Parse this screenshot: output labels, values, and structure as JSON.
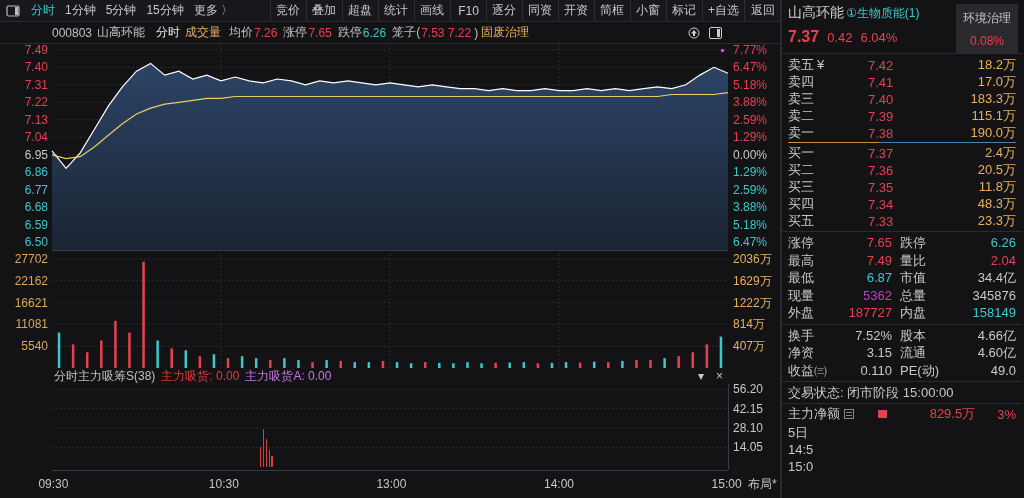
{
  "toolbar": {
    "tabs": [
      {
        "label": "分时",
        "selected": true
      },
      {
        "label": "1分钟",
        "selected": false
      },
      {
        "label": "5分钟",
        "selected": false
      },
      {
        "label": "15分钟",
        "selected": false
      },
      {
        "label": "更多 〉",
        "selected": false
      }
    ],
    "buttons": [
      "竞价",
      "叠加",
      "超盘",
      "统计",
      "画线",
      "F10",
      "逐分",
      "同资",
      "开资",
      "简框",
      "小窗",
      "标记",
      "+自选",
      "返回"
    ]
  },
  "info_bar": {
    "code": "000803",
    "name": "山高环能",
    "mode": "分时",
    "indicator": "成交量",
    "fields": [
      {
        "label": "均价",
        "value": "7.26",
        "kind": "up"
      },
      {
        "label": "涨停",
        "value": "7.65",
        "kind": "up"
      },
      {
        "label": "跌停",
        "value": "6.26",
        "kind": "down"
      },
      {
        "label": "笼子(",
        "value": "7.53 7.22",
        "kind": "up",
        "suffix": ")"
      }
    ],
    "sector": "固废治理"
  },
  "price_chart": {
    "chart_data": {
      "type": "line",
      "categories": [
        null,
        null,
        null,
        null,
        null,
        null,
        null,
        null,
        null,
        null,
        null,
        null,
        null,
        null,
        null,
        null,
        null,
        null,
        null,
        null,
        null,
        null,
        null,
        null,
        null,
        null,
        null,
        null,
        null,
        null,
        null,
        null,
        null,
        null,
        null,
        null,
        null,
        null,
        null,
        null,
        null,
        null,
        null,
        null,
        null,
        null,
        null,
        null,
        null
      ],
      "series": [
        {
          "color": "#ffffff",
          "values": [
            6.97,
            6.88,
            6.96,
            7.08,
            7.2,
            7.3,
            7.38,
            7.42,
            7.36,
            7.38,
            7.34,
            7.36,
            7.33,
            7.35,
            7.33,
            7.32,
            7.34,
            7.33,
            7.31,
            7.33,
            7.32,
            7.33,
            7.32,
            7.31,
            7.32,
            7.31,
            7.3,
            7.31,
            7.3,
            7.29,
            7.29,
            7.28,
            7.29,
            7.28,
            7.28,
            7.29,
            7.28,
            7.28,
            7.29,
            7.28,
            7.29,
            7.28,
            7.29,
            7.3,
            7.29,
            7.31,
            7.36,
            7.4,
            7.37
          ]
        },
        {
          "color": "#e8d060",
          "values": [
            6.95,
            6.93,
            6.94,
            6.99,
            7.05,
            7.11,
            7.16,
            7.19,
            7.21,
            7.22,
            7.23,
            7.24,
            7.24,
            7.25,
            7.25,
            7.25,
            7.25,
            7.25,
            7.25,
            7.25,
            7.25,
            7.25,
            7.25,
            7.25,
            7.25,
            7.25,
            7.25,
            7.25,
            7.25,
            7.25,
            7.25,
            7.25,
            7.25,
            7.25,
            7.25,
            7.25,
            7.25,
            7.25,
            7.25,
            7.25,
            7.25,
            7.25,
            7.25,
            7.25,
            7.26,
            7.26,
            7.26,
            7.26,
            7.27
          ]
        }
      ],
      "ylim": [
        6.46,
        7.52
      ],
      "grid": true,
      "yticks": [
        {
          "value": 7.49,
          "label": "7.49"
        },
        {
          "value": 7.4,
          "label": "7.40"
        },
        {
          "value": 7.31,
          "label": "7.31"
        },
        {
          "value": 7.22,
          "label": "7.22"
        },
        {
          "value": 7.13,
          "label": "7.13"
        },
        {
          "value": 7.04,
          "label": "7.04"
        },
        {
          "value": 6.95,
          "label": "6.95"
        },
        {
          "value": 6.86,
          "label": "6.86"
        },
        {
          "value": 6.77,
          "label": "6.77"
        },
        {
          "value": 6.68,
          "label": "6.68"
        },
        {
          "value": 6.59,
          "label": "6.59"
        },
        {
          "value": 6.5,
          "label": "6.50"
        }
      ]
    },
    "pct_labels": [
      {
        "text": "7.77%",
        "color": "#e8404f"
      },
      {
        "text": "6.47%",
        "color": "#e8404f"
      },
      {
        "text": "5.18%",
        "color": "#e8404f"
      },
      {
        "text": "3.88%",
        "color": "#e8404f"
      },
      {
        "text": "2.59%",
        "color": "#e8404f"
      },
      {
        "text": "1.29%",
        "color": "#e8404f"
      },
      {
        "text": "0.00%",
        "color": "#c8c8c8"
      },
      {
        "text": "1.29%",
        "color": "#3cc8c8"
      },
      {
        "text": "2.59%",
        "color": "#3cc8c8"
      },
      {
        "text": "3.88%",
        "color": "#3cc8c8"
      },
      {
        "text": "5.18%",
        "color": "#3cc8c8"
      },
      {
        "text": "6.47%",
        "color": "#3cc8c8"
      }
    ]
  },
  "volume_chart": {
    "chart_data": {
      "type": "bar",
      "grid": true,
      "categories": [
        null,
        null,
        null,
        null,
        null,
        null,
        null,
        null,
        null,
        null,
        null,
        null,
        null,
        null,
        null,
        null,
        null,
        null,
        null,
        null,
        null,
        null,
        null,
        null,
        null,
        null,
        null,
        null,
        null,
        null,
        null,
        null,
        null,
        null,
        null,
        null,
        null,
        null,
        null,
        null,
        null,
        null,
        null,
        null,
        null,
        null,
        null,
        null
      ],
      "series": [
        {
          "color": "#e8404f",
          "values": [
            0,
            6000,
            4000,
            7000,
            12000,
            9000,
            27000,
            0,
            5000,
            0,
            3000,
            0,
            2500,
            0,
            0,
            2000,
            0,
            0,
            1500,
            0,
            1800,
            0,
            0,
            1800,
            0,
            0,
            1500,
            0,
            0,
            0,
            0,
            1300,
            0,
            0,
            1200,
            0,
            0,
            1400,
            0,
            1500,
            0,
            2000,
            2000,
            0,
            3000,
            4000,
            6000,
            0
          ]
        },
        {
          "color": "#3cc8c8",
          "values": [
            9000,
            0,
            0,
            0,
            0,
            0,
            0,
            7000,
            0,
            4500,
            0,
            3500,
            0,
            3000,
            2500,
            0,
            2500,
            2000,
            0,
            2000,
            0,
            1500,
            1500,
            0,
            1500,
            1200,
            0,
            1300,
            1200,
            1500,
            1200,
            0,
            1400,
            1500,
            0,
            1300,
            1500,
            0,
            1600,
            0,
            1800,
            0,
            0,
            2500,
            0,
            0,
            0,
            8000
          ]
        }
      ],
      "ylim": [
        0,
        30000
      ],
      "yticks": [
        {
          "value": 27702,
          "label": "27702"
        },
        {
          "value": 22162,
          "label": "22162"
        },
        {
          "value": 16621,
          "label": "16621"
        },
        {
          "value": 11081,
          "label": "11081"
        },
        {
          "value": 5540,
          "label": "5540"
        }
      ]
    },
    "amount_labels": [
      "2036万",
      "1629万",
      "1222万",
      "814万",
      "407万"
    ]
  },
  "indicator": {
    "title": "分时主力吸筹S(38)",
    "legend": [
      {
        "text": "主力吸货: 0.00",
        "color": "#e03a3a"
      },
      {
        "text": "主力吸货A: 0.00",
        "color": "#c57ae0"
      }
    ],
    "controls": [
      "▾",
      "×"
    ],
    "chart_data": {
      "type": "bar",
      "grid": true,
      "categories": [
        "09:30",
        null,
        null,
        null,
        null,
        null,
        null,
        null,
        null,
        null,
        null,
        null,
        null,
        null,
        null,
        null,
        null,
        null,
        null,
        null,
        null,
        null,
        null,
        null,
        null,
        null,
        null,
        null,
        null,
        null,
        null,
        null,
        null,
        null,
        null,
        null,
        null,
        null,
        null,
        null,
        null,
        null,
        null,
        null,
        null,
        null,
        null,
        null,
        null,
        null,
        null,
        null,
        null,
        null,
        null,
        null,
        null,
        null,
        null,
        null,
        "10:30",
        null,
        null,
        null,
        null,
        null,
        null,
        null,
        null,
        null,
        null,
        null,
        null,
        null,
        null,
        null,
        null,
        null,
        null,
        null,
        null,
        null,
        null,
        null,
        null,
        null,
        null,
        null,
        null,
        null,
        null,
        null,
        null,
        null,
        null,
        null,
        null,
        null,
        null,
        null,
        null,
        null,
        null,
        null,
        null,
        null,
        null,
        null,
        null,
        null,
        null,
        null,
        null,
        null,
        null,
        null,
        null,
        null,
        null,
        "13:00",
        null,
        null,
        null,
        null,
        null,
        null,
        null,
        null,
        null,
        null,
        null,
        null,
        null,
        null,
        null,
        null,
        null,
        null,
        null,
        null,
        null,
        null,
        null,
        null,
        null,
        null,
        null,
        null,
        null,
        null,
        null,
        null,
        null,
        null,
        null,
        null,
        null,
        null,
        null,
        null,
        null,
        null,
        null,
        null,
        null,
        null,
        null,
        null,
        null,
        null,
        null,
        null,
        null,
        null,
        null,
        null,
        null,
        null,
        "14:00",
        null,
        null,
        null,
        null,
        null,
        null,
        null,
        null,
        null,
        null,
        null,
        null,
        null,
        null,
        null,
        null,
        null,
        null,
        null,
        null,
        null,
        null,
        null,
        null,
        null,
        null,
        null,
        null,
        null,
        null,
        null,
        null,
        null,
        null,
        null,
        null,
        null,
        null,
        null,
        null,
        null,
        null,
        null,
        null,
        null,
        null,
        null,
        null,
        null,
        null,
        null,
        null,
        null,
        null,
        null,
        null,
        null,
        null,
        "15:00"
      ],
      "series": [
        {
          "color": "#e03a3a",
          "values": [
            0,
            0,
            0,
            0,
            0,
            0,
            0,
            0,
            0,
            0,
            0,
            0,
            0,
            0,
            0,
            0,
            0,
            0,
            0,
            0,
            0,
            0,
            0,
            0,
            0,
            0,
            0,
            0,
            0,
            0,
            0,
            0,
            0,
            0,
            0,
            0,
            0,
            0,
            0,
            0,
            0,
            0,
            0,
            0,
            0,
            0,
            0,
            0,
            0,
            0,
            0,
            0,
            0,
            0,
            0,
            0,
            0,
            0,
            0,
            0,
            0,
            0,
            0,
            0,
            0,
            0,
            0,
            0,
            0,
            0,
            0,
            0,
            0,
            14,
            27,
            20,
            12,
            8,
            0,
            0,
            0,
            0,
            0,
            0,
            0,
            0,
            0,
            0,
            0,
            0,
            0,
            0,
            0,
            0,
            0,
            0,
            0,
            0,
            0,
            0,
            0,
            0,
            0,
            0,
            0,
            0,
            0,
            0,
            0,
            0,
            0,
            0,
            0,
            0,
            0,
            0,
            0,
            0,
            0,
            0,
            0,
            0,
            0,
            0,
            0,
            0,
            0,
            0,
            0,
            0,
            0,
            0,
            0,
            0,
            0,
            0,
            0,
            0,
            0,
            0,
            0,
            0,
            0,
            0,
            0,
            0,
            0,
            0,
            0,
            0,
            0,
            0,
            0,
            0,
            0,
            0,
            0,
            0,
            0,
            0,
            0,
            0,
            0,
            0,
            0,
            0,
            0,
            0,
            0,
            0,
            0,
            0,
            0,
            0,
            0,
            0,
            0,
            0,
            0,
            0,
            0,
            0,
            0,
            0,
            0,
            0,
            0,
            0,
            0,
            0,
            0,
            0,
            0,
            0,
            0,
            0,
            0,
            0,
            0,
            0,
            0,
            0,
            0,
            0,
            0,
            0,
            0,
            0,
            0,
            0,
            0,
            0,
            0,
            0,
            0,
            0,
            0,
            0,
            0,
            0,
            0,
            0,
            0,
            0,
            0,
            0,
            0,
            0,
            0,
            0,
            0,
            0,
            0,
            0,
            0,
            0,
            0,
            0
          ]
        }
      ],
      "ylim": [
        -2.5,
        60
      ],
      "yticks": [
        {
          "value": 56.2,
          "label": "56.20"
        },
        {
          "value": 42.15,
          "label": "42.15"
        },
        {
          "value": 28.1,
          "label": "28.10"
        },
        {
          "value": 14.05,
          "label": "14.05"
        }
      ]
    }
  },
  "layout_button": "布局*",
  "quote": {
    "name": "山高环能",
    "tag": "①生物质能(1)",
    "sector": {
      "name": "环境治理",
      "change": "0.08%"
    },
    "price": "7.37",
    "change": "0.42",
    "pct": "6.04%"
  },
  "asks": [
    {
      "label": "卖五",
      "extra": "¥",
      "price": "7.42",
      "volume": "18.2万"
    },
    {
      "label": "卖四",
      "price": "7.41",
      "volume": "17.0万"
    },
    {
      "label": "卖三",
      "price": "7.40",
      "volume": "183.3万"
    },
    {
      "label": "卖二",
      "price": "7.39",
      "volume": "115.1万"
    },
    {
      "label": "卖一",
      "price": "7.38",
      "volume": "190.0万"
    }
  ],
  "bids": [
    {
      "label": "买一",
      "price": "7.37",
      "volume": "2.4万"
    },
    {
      "label": "买二",
      "price": "7.36",
      "volume": "20.5万"
    },
    {
      "label": "买三",
      "price": "7.35",
      "volume": "11.8万"
    },
    {
      "label": "买四",
      "price": "7.34",
      "volume": "48.3万"
    },
    {
      "label": "买五",
      "price": "7.33",
      "volume": "23.3万"
    }
  ],
  "stats": [
    {
      "label": "涨停",
      "value": "7.65",
      "kind": "up"
    },
    {
      "label": "跌停",
      "value": "6.26",
      "kind": "down"
    },
    {
      "label": "最高",
      "value": "7.49",
      "kind": "up"
    },
    {
      "label": "量比",
      "value": "2.04",
      "kind": "up"
    },
    {
      "label": "最低",
      "value": "6.87",
      "kind": "down"
    },
    {
      "label": "市值",
      "value": "34.4亿",
      "kind": "plain"
    },
    {
      "label": "现量",
      "value": "5362",
      "kind": "volume"
    },
    {
      "label": "总量",
      "value": "345876",
      "kind": "plain"
    },
    {
      "label": "外盘",
      "value": "187727",
      "kind": "up"
    },
    {
      "label": "内盘",
      "value": "158149",
      "kind": "down"
    }
  ],
  "finance": [
    {
      "label": "换手",
      "value": "7.52%"
    },
    {
      "label": "股本",
      "value": "4.66亿"
    },
    {
      "label": "净资",
      "value": "3.15"
    },
    {
      "label": "流通",
      "value": "4.60亿"
    },
    {
      "label": "收益㈢",
      "value": "0.110"
    },
    {
      "label": "PE(动)",
      "value": "49.0"
    }
  ],
  "status": "交易状态: 闭市阶段 15:00:00",
  "flow": {
    "label": "主力净额",
    "value": "829.5万",
    "pct": "3%"
  },
  "flow_rows": [
    "5日",
    "14:5",
    "15:0"
  ]
}
